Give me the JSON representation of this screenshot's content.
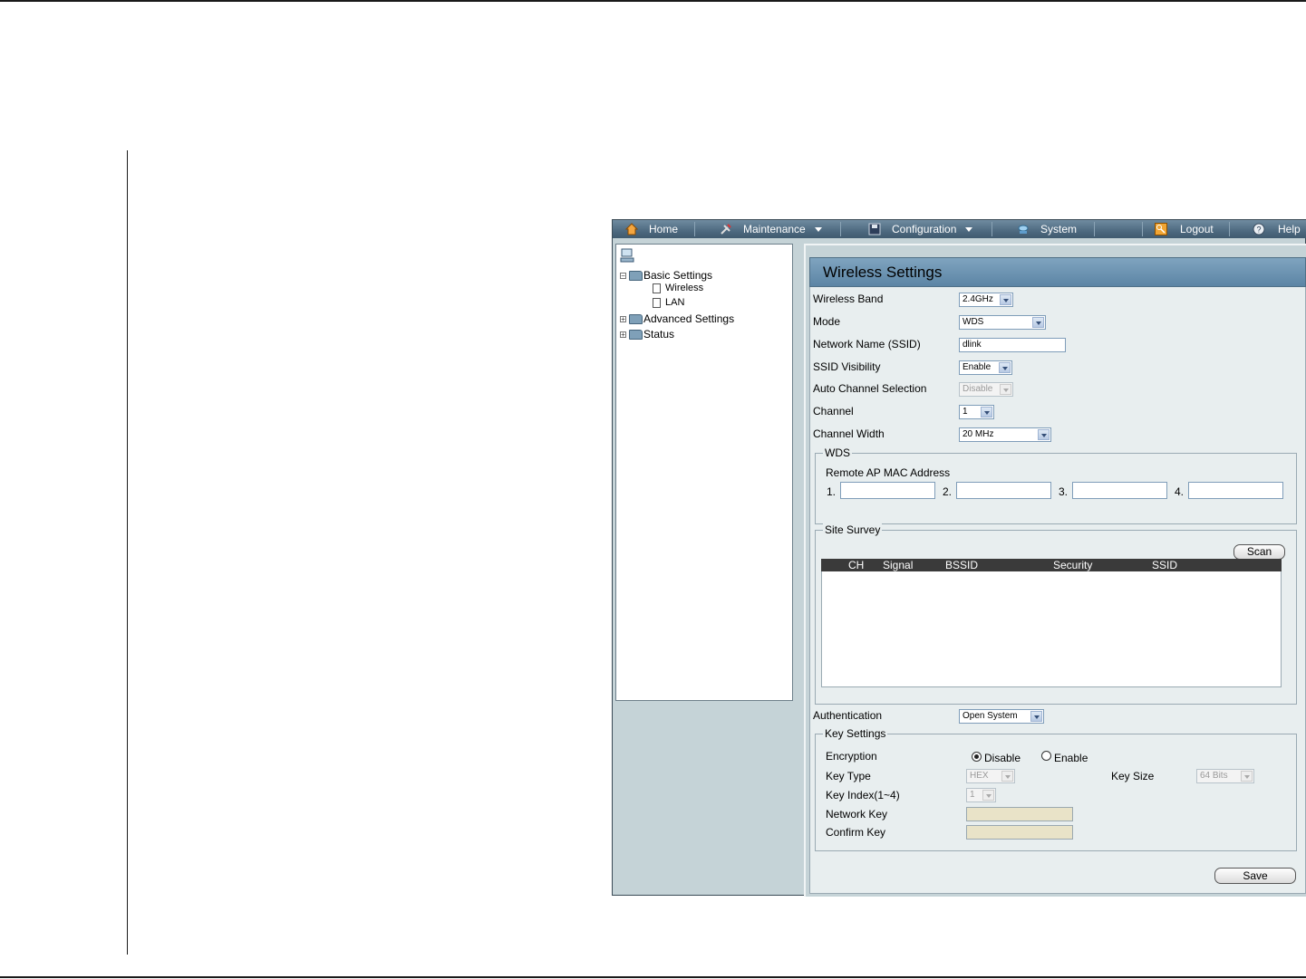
{
  "menubar": {
    "items": [
      {
        "label": "Home",
        "icon": "home-icon"
      },
      {
        "label": "Maintenance",
        "icon": "tools-icon"
      },
      {
        "label": "Configuration",
        "icon": "floppy-disk-icon"
      },
      {
        "label": "System",
        "icon": "network-icon"
      },
      {
        "label": "Logout",
        "icon": "key-icon"
      },
      {
        "label": "Help",
        "icon": "help-icon"
      }
    ]
  },
  "tree": {
    "root_icon": "computer-icon",
    "items": [
      {
        "label": "Basic Settings",
        "type": "folder",
        "expanded": true
      },
      {
        "label": "Wireless",
        "type": "page"
      },
      {
        "label": "LAN",
        "type": "page"
      },
      {
        "label": "Advanced Settings",
        "type": "folder",
        "expanded": false
      },
      {
        "label": "Status",
        "type": "folder",
        "expanded": false
      }
    ]
  },
  "panel": {
    "title": "Wireless Settings",
    "fields": {
      "wireless_band": {
        "label": "Wireless Band",
        "value": "2.4GHz"
      },
      "mode": {
        "label": "Mode",
        "value": "WDS"
      },
      "ssid": {
        "label": "Network Name (SSID)",
        "value": "dlink"
      },
      "ssid_visibility": {
        "label": "SSID Visibility",
        "value": "Enable"
      },
      "auto_channel": {
        "label": "Auto Channel Selection",
        "value": "Disable"
      },
      "channel": {
        "label": "Channel",
        "value": "1"
      },
      "channel_width": {
        "label": "Channel Width",
        "value": "20 MHz"
      }
    },
    "wds": {
      "legend": "WDS",
      "remote_label": "Remote AP MAC Address",
      "slots": [
        "1.",
        "2.",
        "3.",
        "4."
      ]
    },
    "site_survey": {
      "legend": "Site Survey",
      "scan_label": "Scan",
      "columns": [
        "CH",
        "Signal",
        "BSSID",
        "Security",
        "SSID"
      ]
    },
    "authentication": {
      "label": "Authentication",
      "value": "Open System"
    },
    "key_settings": {
      "legend": "Key Settings",
      "encryption_label": "Encryption",
      "disable_label": "Disable",
      "enable_label": "Enable",
      "encryption_value": "Disable",
      "key_type_label": "Key Type",
      "key_type_value": "HEX",
      "key_size_label": "Key Size",
      "key_size_value": "64 Bits",
      "key_index_label": "Key Index(1~4)",
      "key_index_value": "1",
      "network_key_label": "Network Key",
      "confirm_key_label": "Confirm Key"
    },
    "save_label": "Save"
  }
}
